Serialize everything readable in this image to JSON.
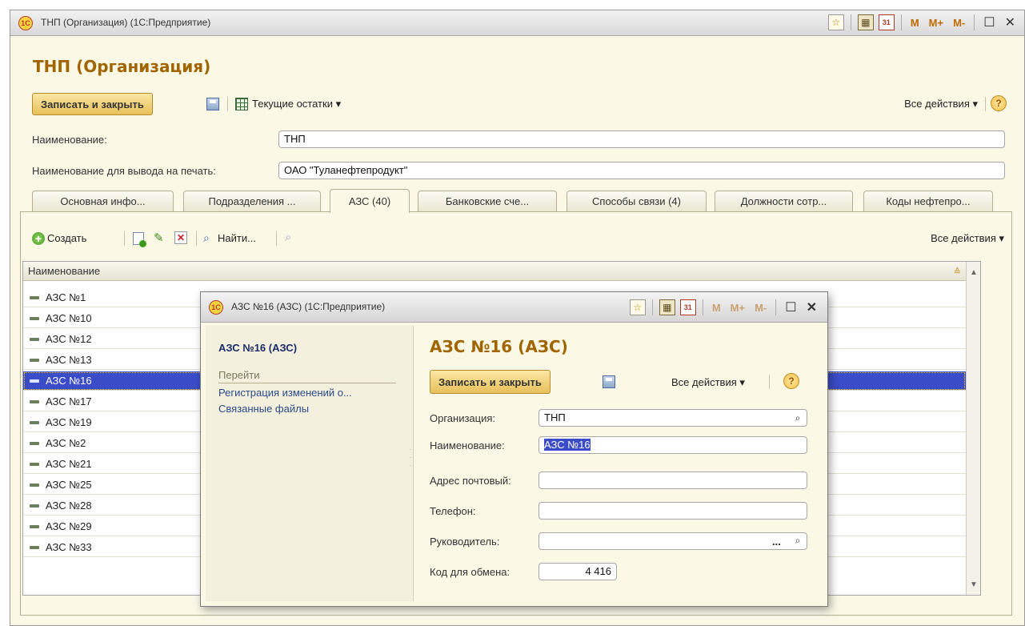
{
  "window": {
    "title": "ТНП (Организация)  (1С:Предприятие)",
    "logo": "1С",
    "heading": "ТНП (Организация)",
    "toolbar_icons": {
      "m": "M",
      "mplus": "M+",
      "mminus": "M-"
    }
  },
  "toolbar": {
    "save_close": "Записать и закрыть",
    "balances": "Текущие остатки ▾",
    "all_actions": "Все действия ▾",
    "help": "?"
  },
  "form": {
    "name_label": "Наименование:",
    "name_value": "ТНП",
    "print_name_label": "Наименование для вывода на печать:",
    "print_name_value": "ОАО \"Туланефтепродукт\""
  },
  "tabs": [
    {
      "label": "Основная инфо..."
    },
    {
      "label": "Подразделения ..."
    },
    {
      "label": "АЗС (40)"
    },
    {
      "label": "Банковские сче..."
    },
    {
      "label": "Способы связи (4)"
    },
    {
      "label": "Должности сотр..."
    },
    {
      "label": "Коды нефтепро..."
    }
  ],
  "list_toolbar": {
    "create": "Создать",
    "find": "Найти...",
    "all_actions": "Все действия ▾"
  },
  "grid": {
    "header": "Наименование",
    "rows": [
      "АЗС №1",
      "АЗС №10",
      "АЗС №12",
      "АЗС №13",
      "АЗС №16",
      "АЗС №17",
      "АЗС №19",
      "АЗС №2",
      "АЗС №21",
      "АЗС №25",
      "АЗС №28",
      "АЗС №29",
      "АЗС №33"
    ],
    "selected": "АЗС №16"
  },
  "popup": {
    "title": "АЗС №16 (АЗС)  (1С:Предприятие)",
    "side_title": "АЗС №16 (АЗС)",
    "nav_header": "Перейти",
    "nav_links": [
      "Регистрация изменений о...",
      "Связанные файлы"
    ],
    "heading": "АЗС №16 (АЗС)",
    "save_close": "Записать и закрыть",
    "all_actions": "Все действия ▾",
    "help": "?",
    "fields": {
      "org_label": "Организация:",
      "org_value": "ТНП",
      "name_label": "Наименование:",
      "name_value": "АЗС №16",
      "address_label": "Адрес почтовый:",
      "address_value": "",
      "phone_label": "Телефон:",
      "phone_value": "",
      "manager_label": "Руководитель:",
      "manager_value": "",
      "code_label": "Код для обмена:",
      "code_value": "4 416"
    }
  },
  "colors": {
    "heading": "#a06400",
    "button_bg": "#e7c05a",
    "selection": "#3b4cc8",
    "panel_bg": "#fbf8e6"
  }
}
